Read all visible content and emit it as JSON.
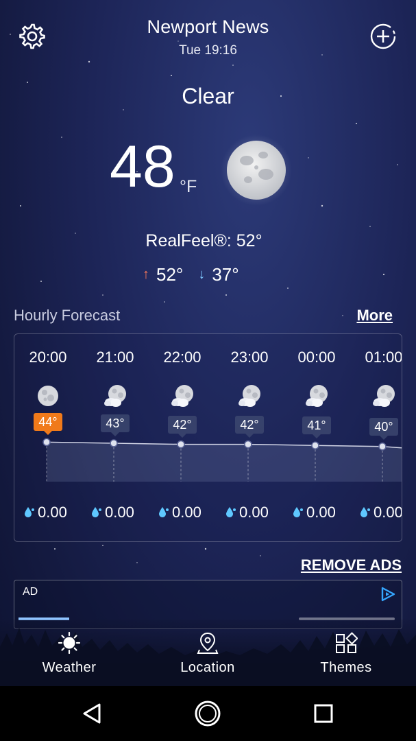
{
  "header": {
    "city": "Newport News",
    "datetime": "Tue 19:16",
    "settings_icon": "gear-icon",
    "add_icon": "add-location-icon"
  },
  "current": {
    "condition": "Clear",
    "temperature": "48",
    "unit": "°F",
    "icon": "moon-icon",
    "realfeel": "RealFeel®: 52°",
    "high": "52°",
    "low": "37°"
  },
  "hourly": {
    "title": "Hourly Forecast",
    "more_label": "More",
    "hours": [
      {
        "time": "20:00",
        "temp": "44°",
        "precip": "0.00",
        "icon": "moon-icon"
      },
      {
        "time": "21:00",
        "temp": "43°",
        "precip": "0.00",
        "icon": "moon-cloud-icon"
      },
      {
        "time": "22:00",
        "temp": "42°",
        "precip": "0.00",
        "icon": "moon-cloud-icon"
      },
      {
        "time": "23:00",
        "temp": "42°",
        "precip": "0.00",
        "icon": "moon-cloud-icon"
      },
      {
        "time": "00:00",
        "temp": "41°",
        "precip": "0.00",
        "icon": "moon-cloud-icon"
      },
      {
        "time": "01:00",
        "temp": "40°",
        "precip": "0.00",
        "icon": "moon-cloud-icon"
      }
    ]
  },
  "ads": {
    "remove_label": "REMOVE ADS",
    "ad_label": "AD"
  },
  "nav": {
    "items": [
      {
        "label": "Weather",
        "icon": "sun-icon"
      },
      {
        "label": "Location",
        "icon": "location-pin-icon"
      },
      {
        "label": "Themes",
        "icon": "themes-grid-icon"
      }
    ]
  },
  "colors": {
    "accent_now": "#f07a1a",
    "high_arrow": "#ff7a59",
    "low_arrow": "#7fc8ff",
    "drop": "#5fc8ff"
  }
}
